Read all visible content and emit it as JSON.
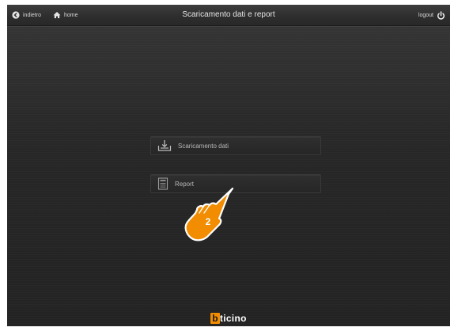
{
  "topbar": {
    "back_label": "indietro",
    "home_label": "home",
    "title": "Scaricamento dati e report",
    "logout_label": "logout"
  },
  "menu": {
    "download_label": "Scaricamento dati",
    "report_label": "Report"
  },
  "annotation": {
    "step": "2"
  },
  "brand": {
    "logo_first": "b",
    "logo_rest": "ticino",
    "accent_color": "#f28c00"
  },
  "icons": {
    "back": "back-arrow-icon",
    "home": "home-icon",
    "logout": "power-icon",
    "download": "download-tray-icon",
    "report": "document-icon",
    "hand": "pointing-hand-icon"
  }
}
